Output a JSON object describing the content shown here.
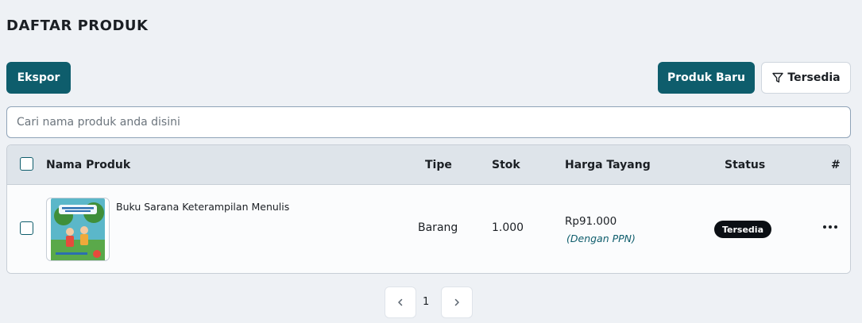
{
  "page": {
    "title": "DAFTAR PRODUK"
  },
  "toolbar": {
    "export_label": "Ekspor",
    "new_product_label": "Produk Baru",
    "filter_label": "Tersedia"
  },
  "search": {
    "placeholder": "Cari nama produk anda disini",
    "value": ""
  },
  "table": {
    "columns": {
      "name": "Nama Produk",
      "type": "Tipe",
      "stock": "Stok",
      "price": "Harga Tayang",
      "status": "Status",
      "actions": "#"
    },
    "rows": [
      {
        "name": "Buku Sarana Keterampilan Menulis",
        "type": "Barang",
        "stock": "1.000",
        "price": "Rp91.000",
        "price_note": "(Dengan PPN)",
        "status": "Tersedia",
        "thumbnail_icon": "book-cover-icon"
      }
    ]
  },
  "pagination": {
    "current_page": "1"
  },
  "colors": {
    "primary": "#0e5d6c",
    "badge": "#0b0f14",
    "background": "#eef1f5"
  }
}
